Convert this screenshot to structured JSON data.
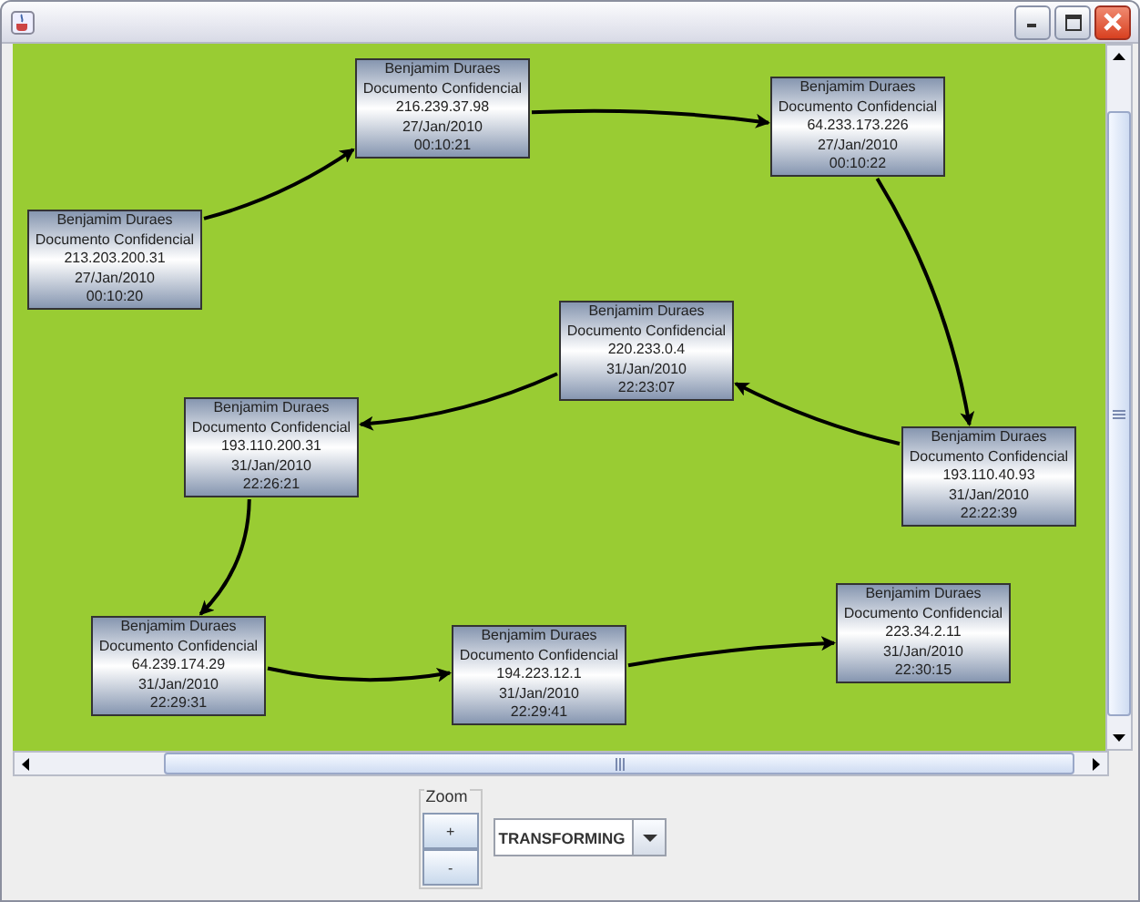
{
  "graph": {
    "nodes": [
      {
        "name": "Benjamim Duraes",
        "doc": "Documento Confidencial",
        "ip": "213.203.200.31",
        "date": "27/Jan/2010",
        "time": "00:10:20"
      },
      {
        "name": "Benjamim Duraes",
        "doc": "Documento Confidencial",
        "ip": "216.239.37.98",
        "date": "27/Jan/2010",
        "time": "00:10:21"
      },
      {
        "name": "Benjamim Duraes",
        "doc": "Documento Confidencial",
        "ip": "64.233.173.226",
        "date": "27/Jan/2010",
        "time": "00:10:22"
      },
      {
        "name": "Benjamim Duraes",
        "doc": "Documento Confidencial",
        "ip": "193.110.40.93",
        "date": "31/Jan/2010",
        "time": "22:22:39"
      },
      {
        "name": "Benjamim Duraes",
        "doc": "Documento Confidencial",
        "ip": "220.233.0.4",
        "date": "31/Jan/2010",
        "time": "22:23:07"
      },
      {
        "name": "Benjamim Duraes",
        "doc": "Documento Confidencial",
        "ip": "193.110.200.31",
        "date": "31/Jan/2010",
        "time": "22:26:21"
      },
      {
        "name": "Benjamim Duraes",
        "doc": "Documento Confidencial",
        "ip": "64.239.174.29",
        "date": "31/Jan/2010",
        "time": "22:29:31"
      },
      {
        "name": "Benjamim Duraes",
        "doc": "Documento Confidencial",
        "ip": "194.223.12.1",
        "date": "31/Jan/2010",
        "time": "22:29:41"
      },
      {
        "name": "Benjamim Duraes",
        "doc": "Documento Confidencial",
        "ip": "223.34.2.11",
        "date": "31/Jan/2010",
        "time": "22:30:15"
      }
    ]
  },
  "zoom": {
    "title": "Zoom",
    "buttons": [
      "+",
      "-"
    ]
  },
  "mode": {
    "value": "TRANSFORMING"
  }
}
